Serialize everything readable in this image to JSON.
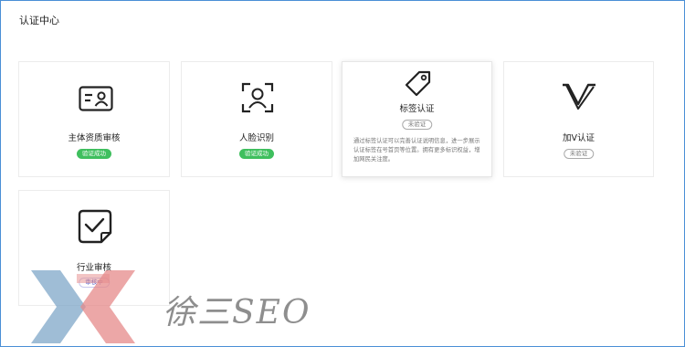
{
  "page": {
    "title": "认证中心"
  },
  "cards": [
    {
      "icon": "id-card-icon",
      "name": "主体资质审核",
      "status": "验证成功",
      "status_type": "success"
    },
    {
      "icon": "face-scan-icon",
      "name": "人脸识别",
      "status": "验证成功",
      "status_type": "success"
    },
    {
      "icon": "tag-icon",
      "name": "标签认证",
      "status": "未验证",
      "status_type": "pending",
      "description": "通过标签认证可以完善认证说明信息，进一步展示认证标签在号首页等位置。拥有更多标识权益，增加网民关注度。"
    },
    {
      "icon": "v-badge-icon",
      "name": "加V认证",
      "status": "未验证",
      "status_type": "pending"
    },
    {
      "icon": "checkbox-document-icon",
      "name": "行业审核",
      "status": "审核中",
      "status_type": "review"
    }
  ],
  "watermark": {
    "text": "徐三SEO"
  },
  "colors": {
    "success": "#3fbf5e",
    "frame": "#4a8fd6",
    "watermark_blue": "#7fa7c8",
    "watermark_red": "#e58a8a"
  }
}
